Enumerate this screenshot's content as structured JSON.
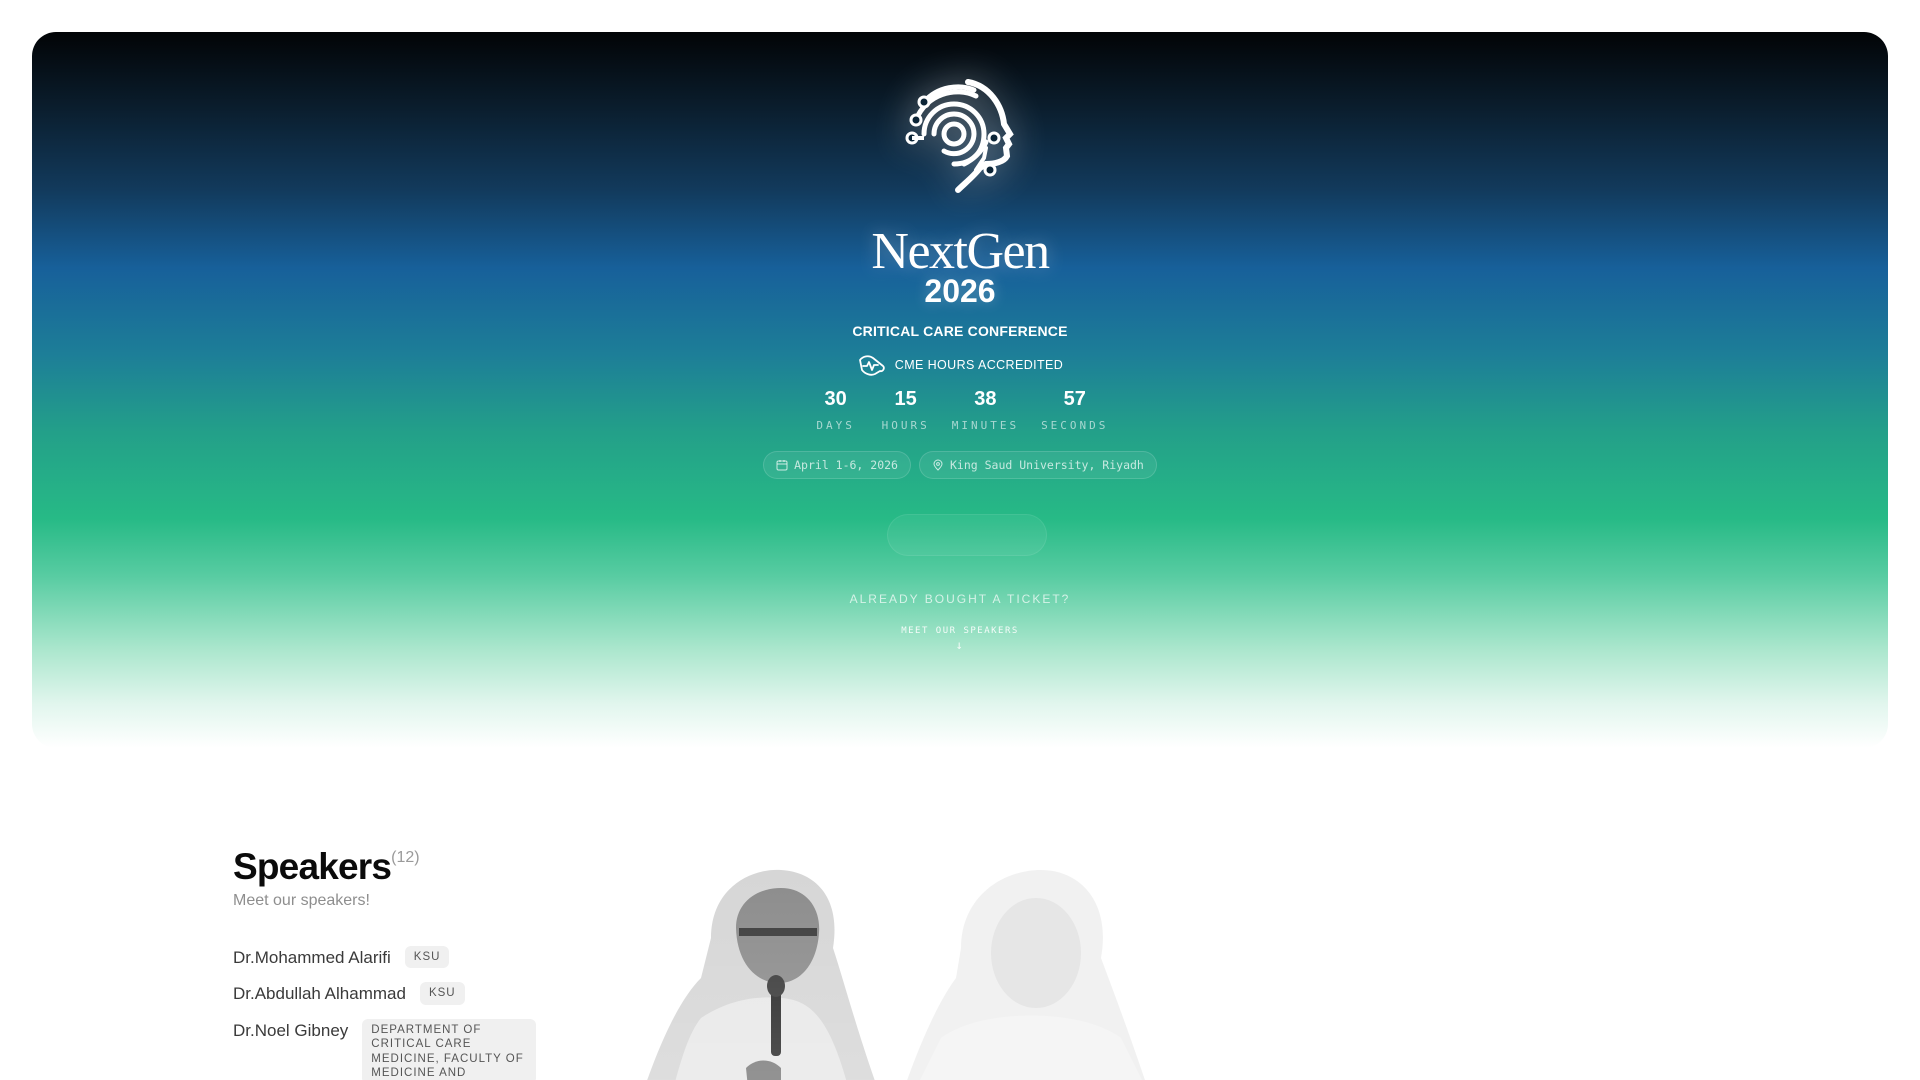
{
  "hero": {
    "brand_name": "NextGen",
    "brand_year": "2026",
    "tagline": "CRITICAL CARE CONFERENCE",
    "cme_label": "CME HOURS ACCREDITED",
    "countdown": [
      {
        "value": "30",
        "label": "DAYS"
      },
      {
        "value": "15",
        "label": "HOURS"
      },
      {
        "value": "38",
        "label": "MINUTES"
      },
      {
        "value": "57",
        "label": "SECONDS"
      }
    ],
    "date_chip": "April 1-6, 2026",
    "location_chip": "King Saud University, Riyadh",
    "already_bought": "ALREADY BOUGHT A TICKET?",
    "meet_speakers": "MEET OUR SPEAKERS",
    "arrow": "↓"
  },
  "speakers": {
    "title": "Speakers",
    "count": "(12)",
    "subtitle": "Meet our speakers!",
    "items": [
      {
        "name": "Dr.Mohammed Alarifi",
        "tag": "KSU"
      },
      {
        "name": "Dr.Abdullah Alhammad",
        "tag": "KSU"
      },
      {
        "name": "Dr.Noel Gibney",
        "tag": "DEPARTMENT OF CRITICAL CARE MEDICINE, FACULTY OF MEDICINE AND"
      }
    ]
  },
  "colors": {
    "hero_top": "#020406",
    "hero_blue": "#17609a",
    "hero_green": "#27ba86",
    "text_light": "#ffffff"
  },
  "icons": [
    "brain-circuit-logo-icon",
    "heartbeat-hand-icon",
    "calendar-icon",
    "map-pin-icon",
    "arrow-down-icon"
  ]
}
